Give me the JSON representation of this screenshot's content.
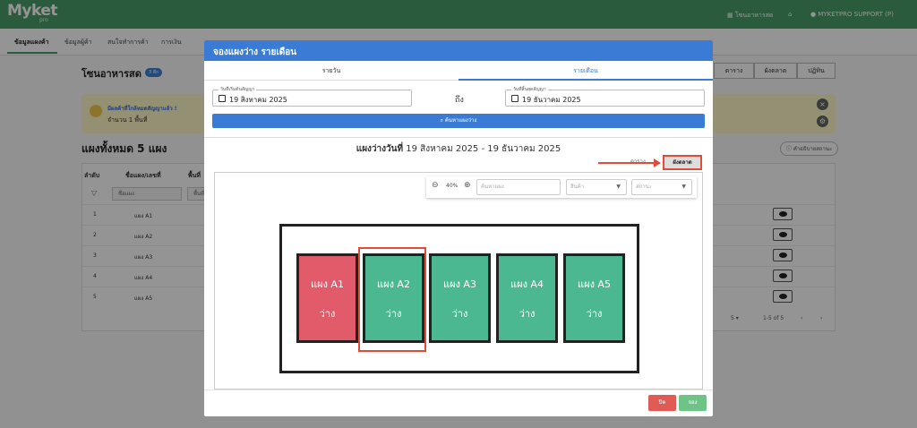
{
  "app": {
    "logo": "Myket",
    "logo_sub": "pro",
    "top_right": {
      "zone": "โซนอาหารสด",
      "user": "MYKETPRO SUPPORT (P)"
    }
  },
  "subnav": {
    "tabs": [
      "ข้อมูลแผงค้า",
      "ข้อมูลผู้ค้า",
      "สนใจทำการค้า",
      "การเงิน"
    ]
  },
  "page": {
    "zone_title": "โซนอาหารสด",
    "zone_badge": "3 ตึก",
    "view_buttons": [
      "ตาราง",
      "ผังตลาด",
      "ปฏิทิน"
    ],
    "notice": {
      "title": "มีผลค้าที่ใกล้หมดสัญญาแล้ว !",
      "count": "จำนวน 1 พื้นที่"
    },
    "total": "แผงทั้งหมด 5 แผง",
    "howto": "คำอธิบายสถานะ",
    "table": {
      "headers": [
        "ลำดับ",
        "ชื่อแผง/เลขที่",
        "พื้นที่"
      ],
      "filter_name": "ชื่อแผง",
      "filter_area": "พื้นที่",
      "rows": [
        {
          "no": "1",
          "name": "แผง A1"
        },
        {
          "no": "2",
          "name": "แผง A2"
        },
        {
          "no": "3",
          "name": "แผง A3"
        },
        {
          "no": "4",
          "name": "แผง A4"
        },
        {
          "no": "5",
          "name": "แผง A5"
        }
      ],
      "pager": {
        "per_page": "5",
        "range": "1-5 of 5"
      }
    }
  },
  "modal": {
    "title": "จองแผงว่าง รายเดือน",
    "tabs": [
      "รายวัน",
      "รายเดือน"
    ],
    "start": {
      "label": "วันที่เริ่มต้นสัญญา",
      "value": "19 สิงหาคม 2025"
    },
    "to_label": "ถึง",
    "end": {
      "label": "วันที่สิ้นสุดสัญญา",
      "value": "19 ธันวาคม 2025"
    },
    "search_label": "ค้นหาแผงว่าง",
    "range_bold": "แผงว่างวันที่",
    "range_dates": "19 สิงหาคม 2025 - 19 ธันวาคม 2025",
    "view_table": "ตาราง",
    "view_map": "ผังตลาด",
    "tools": {
      "zoom": "40%",
      "search_placeholder": "ค้นหาแผง",
      "product_placeholder": "สินค้า",
      "status_placeholder": "สถานะ"
    },
    "stalls": [
      {
        "name": "แผง A1",
        "status": "ว่าง",
        "color": "#e15b6a"
      },
      {
        "name": "แผง A2",
        "status": "ว่าง",
        "color": "#4cb892"
      },
      {
        "name": "แผง A3",
        "status": "ว่าง",
        "color": "#4cb892"
      },
      {
        "name": "แผง A4",
        "status": "ว่าง",
        "color": "#4cb892"
      },
      {
        "name": "แผง A5",
        "status": "ว่าง",
        "color": "#4cb892"
      }
    ],
    "close_label": "ปิด",
    "book_label": "จอง"
  }
}
